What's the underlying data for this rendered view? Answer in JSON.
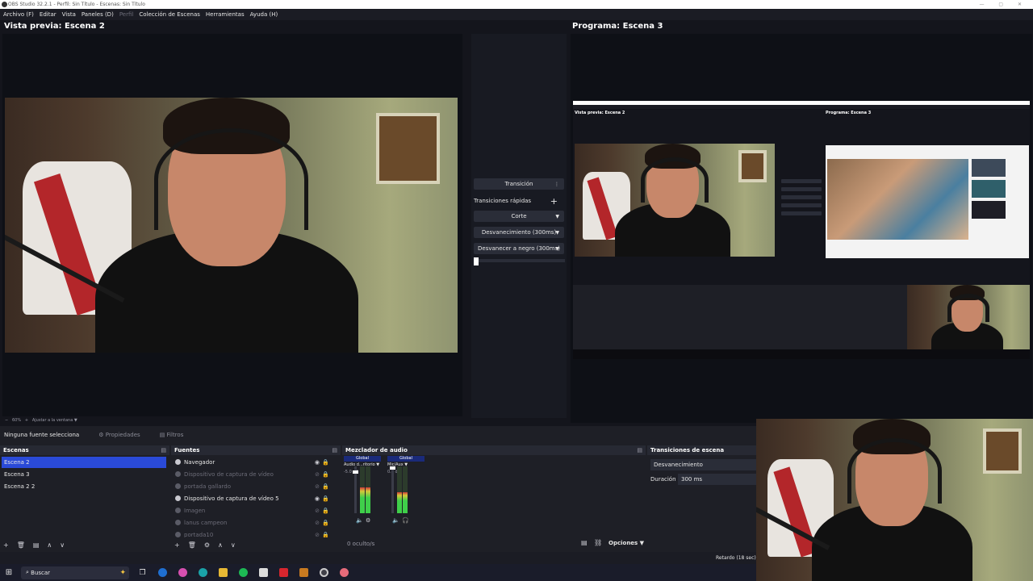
{
  "window": {
    "title": "OBS Studio 32.2.1 - Perfil: Sin Título - Escenas: Sin Título"
  },
  "menu": [
    {
      "label": "Archivo (F)",
      "dim": false
    },
    {
      "label": "Editar",
      "dim": false
    },
    {
      "label": "Vista",
      "dim": false
    },
    {
      "label": "Paneles (D)",
      "dim": false
    },
    {
      "label": "Perfil",
      "dim": true
    },
    {
      "label": "Colección de Escenas",
      "dim": false
    },
    {
      "label": "Herramientas",
      "dim": false
    },
    {
      "label": "Ayuda (H)",
      "dim": false
    }
  ],
  "preview": {
    "title": "Vista previa: Escena 2"
  },
  "program": {
    "title": "Programa: Escena 3"
  },
  "transitions_panel": {
    "transition_button": "Transición",
    "quick_label": "Transiciones rápidas",
    "quick_add": "+",
    "items": [
      "Corte",
      "Desvanecimiento (300ms)",
      "Desvanecer a negro (300ms)"
    ]
  },
  "zoom": {
    "value": "60%",
    "fit": "Ajustar a la ventana"
  },
  "props_bar": {
    "no_source": "Ninguna fuente selecciona",
    "properties": "Propiedades",
    "filters": "Filtros"
  },
  "scenes": {
    "title": "Escenas",
    "items": [
      "Escena 2",
      "Escena 3",
      "Escena 2 2"
    ],
    "selected_index": 0
  },
  "sources": {
    "title": "Fuentes",
    "items": [
      {
        "label": "Navegador",
        "visible": true
      },
      {
        "label": "Dispositivo de captura de vídeo",
        "visible": false
      },
      {
        "label": "portada gallardo",
        "visible": false
      },
      {
        "label": "Dispositivo de captura de vídeo 5",
        "visible": true
      },
      {
        "label": "Imagen",
        "visible": false
      },
      {
        "label": "lanus campeon",
        "visible": false
      },
      {
        "label": "portada10",
        "visible": false
      }
    ]
  },
  "mixer": {
    "title": "Mezclador de audio",
    "channels": [
      {
        "scope": "Global",
        "name": "Audio d...ritorio",
        "db": "-5.0 dB",
        "level": 0.55
      },
      {
        "scope": "Global",
        "name": "Mic/Aux",
        "db": "0.0 dB",
        "level": 0.45
      }
    ],
    "hidden": "0 oculto/s",
    "options": "Opciones"
  },
  "scene_transitions": {
    "title": "Transiciones de escena",
    "selected": "Desvanecimiento",
    "duration_label": "Duración",
    "duration_value": "300 ms"
  },
  "status": {
    "delay": "Retardo (18 sec)"
  },
  "taskbar": {
    "search_placeholder": "Buscar"
  }
}
